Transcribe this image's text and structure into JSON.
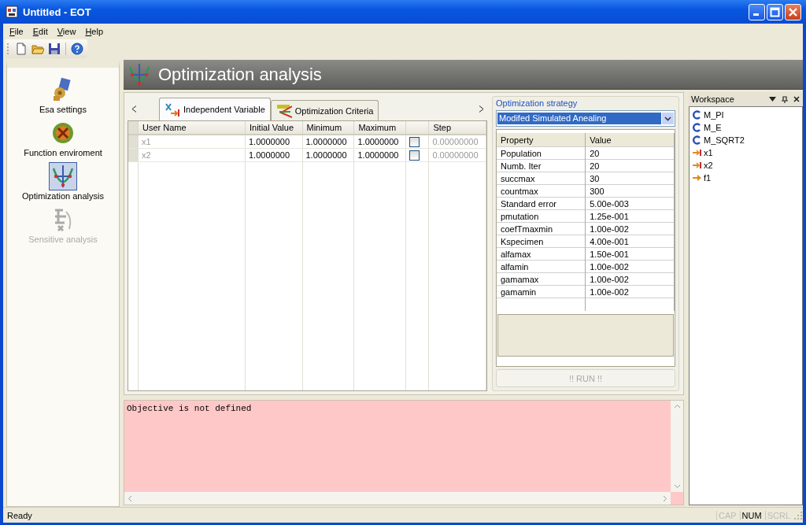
{
  "window": {
    "title": "Untitled - EOT"
  },
  "menu": [
    "File",
    "Edit",
    "View",
    "Help"
  ],
  "menu_mnemonics": true,
  "sidebar": {
    "items": [
      {
        "label": "Esa settings",
        "kind": "settings",
        "selected": false,
        "disabled": false
      },
      {
        "label": "Function enviroment",
        "kind": "function",
        "selected": false,
        "disabled": false
      },
      {
        "label": "Optimization analysis",
        "kind": "optimization",
        "selected": true,
        "disabled": false
      },
      {
        "label": "Sensitive analysis",
        "kind": "sensitivity",
        "selected": false,
        "disabled": true
      }
    ]
  },
  "header": {
    "title": "Optimization analysis"
  },
  "tabs": [
    {
      "label": "Independent Variable",
      "kind": "variable",
      "selected": true
    },
    {
      "label": "Optimization Criteria",
      "kind": "criteria",
      "selected": false
    }
  ],
  "table": {
    "columns": [
      {
        "label": "User Name",
        "kind": "text"
      },
      {
        "label": "Initial Value",
        "kind": "text"
      },
      {
        "label": "Minimum",
        "kind": "text"
      },
      {
        "label": "Maximum",
        "kind": "text"
      },
      {
        "kind": "check"
      },
      {
        "label": "Step",
        "kind": "text"
      }
    ],
    "rows": [
      {
        "user_name": "x1",
        "initial_value": "1.0000000",
        "minimum": "1.0000000",
        "maximum": "1.0000000",
        "checked": false,
        "step": "0.00000000"
      },
      {
        "user_name": "x2",
        "initial_value": "1.0000000",
        "minimum": "1.0000000",
        "maximum": "1.0000000",
        "checked": false,
        "step": "0.00000000"
      }
    ]
  },
  "strategy": {
    "label": "Optimization strategy",
    "value": "Modifed Simulated Anealing"
  },
  "properties": {
    "columns": [
      "Property",
      "Value"
    ],
    "rows": [
      {
        "property": "Population",
        "value": "20"
      },
      {
        "property": "Numb. Iter",
        "value": "20"
      },
      {
        "property": "succmax",
        "value": "30"
      },
      {
        "property": "countmax",
        "value": "300"
      },
      {
        "property": "Standard error",
        "value": "5.00e-003"
      },
      {
        "property": "pmutation",
        "value": "1.25e-001"
      },
      {
        "property": "coefTmaxmin",
        "value": "1.00e-002"
      },
      {
        "property": "Kspecimen",
        "value": "4.00e-001"
      },
      {
        "property": "alfamax",
        "value": "1.50e-001"
      },
      {
        "property": "alfamin",
        "value": "1.00e-002"
      },
      {
        "property": "gamamax",
        "value": "1.00e-002"
      },
      {
        "property": "gamamin",
        "value": "1.00e-002"
      }
    ]
  },
  "run_button": {
    "label": "!! RUN !!",
    "disabled": true
  },
  "output": {
    "text": "Objective is not defined"
  },
  "workspace": {
    "title": "Workspace",
    "items": [
      {
        "label": "M_PI",
        "kind": "constant"
      },
      {
        "label": "M_E",
        "kind": "constant"
      },
      {
        "label": "M_SQRT2",
        "kind": "constant"
      },
      {
        "label": "x1",
        "kind": "variable"
      },
      {
        "label": "x2",
        "kind": "variable"
      },
      {
        "label": "f1",
        "kind": "function"
      }
    ]
  },
  "status_bar": {
    "text": "Ready",
    "indicators": [
      {
        "label": "CAP",
        "on": false
      },
      {
        "label": "NUM",
        "on": true
      },
      {
        "label": "SCRL",
        "on": false
      }
    ]
  }
}
